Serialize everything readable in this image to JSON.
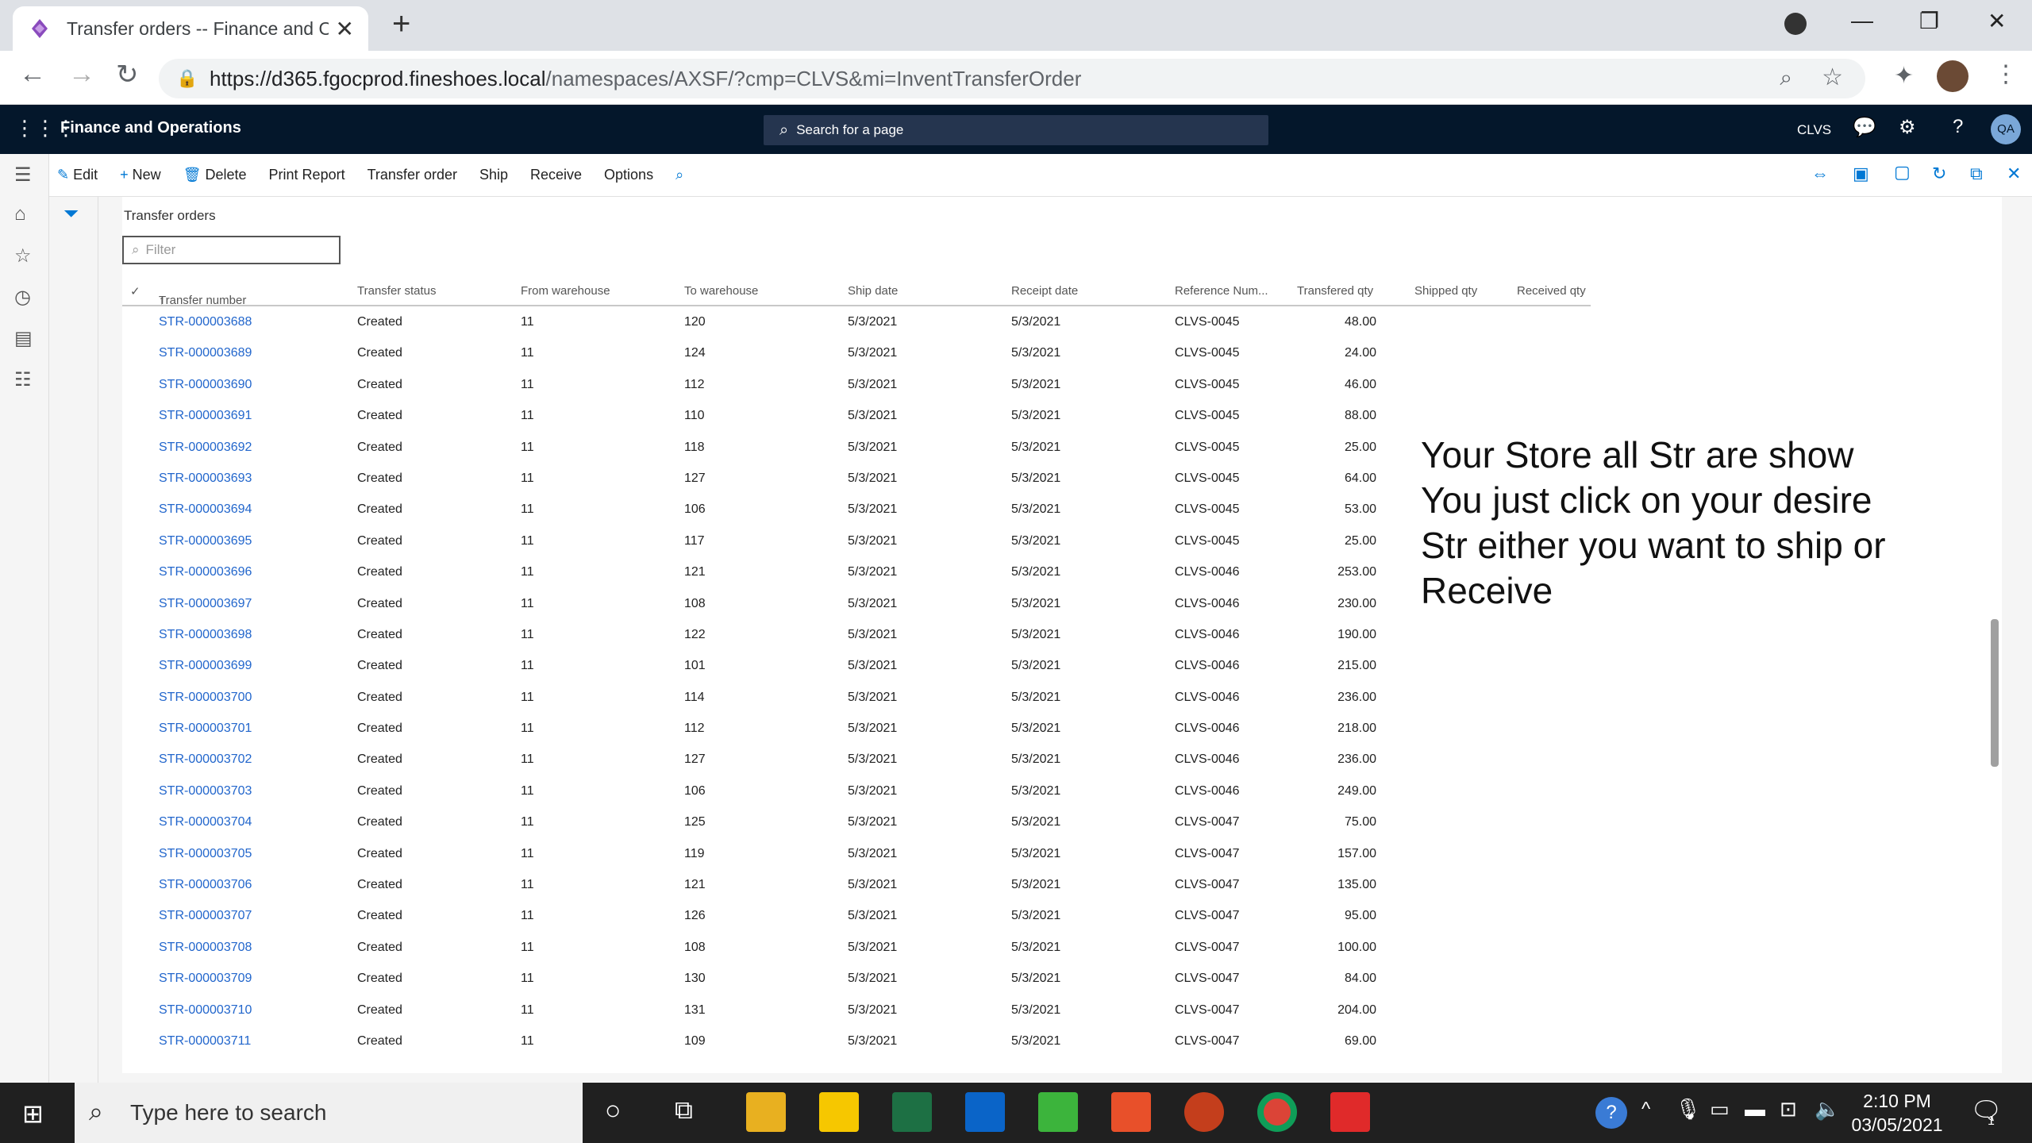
{
  "browser": {
    "tab_title": "Transfer orders -- Finance and Op",
    "url_host": "https://d365.fgocprod.fineshoes.local",
    "url_path": "/namespaces/AXSF/?cmp=CLVS&mi=InventTransferOrder"
  },
  "app": {
    "name": "Finance and Operations",
    "search_placeholder": "Search for a page",
    "company": "CLVS",
    "avatar": "QA"
  },
  "actions": {
    "edit": "Edit",
    "new": "New",
    "delete": "Delete",
    "print_report": "Print Report",
    "transfer_order": "Transfer order",
    "ship": "Ship",
    "receive": "Receive",
    "options": "Options"
  },
  "page": {
    "title": "Transfer orders",
    "filter_placeholder": "Filter"
  },
  "grid": {
    "columns": [
      "Transfer number",
      "Transfer status",
      "From warehouse",
      "To warehouse",
      "Ship date",
      "Receipt date",
      "Reference Num...",
      "Transfered qty",
      "Shipped qty",
      "Received qty"
    ],
    "sort_indicator": "↑",
    "rows": [
      [
        "STR-000003688",
        "Created",
        "11",
        "120",
        "5/3/2021",
        "5/3/2021",
        "CLVS-0045",
        "48.00"
      ],
      [
        "STR-000003689",
        "Created",
        "11",
        "124",
        "5/3/2021",
        "5/3/2021",
        "CLVS-0045",
        "24.00"
      ],
      [
        "STR-000003690",
        "Created",
        "11",
        "112",
        "5/3/2021",
        "5/3/2021",
        "CLVS-0045",
        "46.00"
      ],
      [
        "STR-000003691",
        "Created",
        "11",
        "110",
        "5/3/2021",
        "5/3/2021",
        "CLVS-0045",
        "88.00"
      ],
      [
        "STR-000003692",
        "Created",
        "11",
        "118",
        "5/3/2021",
        "5/3/2021",
        "CLVS-0045",
        "25.00"
      ],
      [
        "STR-000003693",
        "Created",
        "11",
        "127",
        "5/3/2021",
        "5/3/2021",
        "CLVS-0045",
        "64.00"
      ],
      [
        "STR-000003694",
        "Created",
        "11",
        "106",
        "5/3/2021",
        "5/3/2021",
        "CLVS-0045",
        "53.00"
      ],
      [
        "STR-000003695",
        "Created",
        "11",
        "117",
        "5/3/2021",
        "5/3/2021",
        "CLVS-0045",
        "25.00"
      ],
      [
        "STR-000003696",
        "Created",
        "11",
        "121",
        "5/3/2021",
        "5/3/2021",
        "CLVS-0046",
        "253.00"
      ],
      [
        "STR-000003697",
        "Created",
        "11",
        "108",
        "5/3/2021",
        "5/3/2021",
        "CLVS-0046",
        "230.00"
      ],
      [
        "STR-000003698",
        "Created",
        "11",
        "122",
        "5/3/2021",
        "5/3/2021",
        "CLVS-0046",
        "190.00"
      ],
      [
        "STR-000003699",
        "Created",
        "11",
        "101",
        "5/3/2021",
        "5/3/2021",
        "CLVS-0046",
        "215.00"
      ],
      [
        "STR-000003700",
        "Created",
        "11",
        "114",
        "5/3/2021",
        "5/3/2021",
        "CLVS-0046",
        "236.00"
      ],
      [
        "STR-000003701",
        "Created",
        "11",
        "112",
        "5/3/2021",
        "5/3/2021",
        "CLVS-0046",
        "218.00"
      ],
      [
        "STR-000003702",
        "Created",
        "11",
        "127",
        "5/3/2021",
        "5/3/2021",
        "CLVS-0046",
        "236.00"
      ],
      [
        "STR-000003703",
        "Created",
        "11",
        "106",
        "5/3/2021",
        "5/3/2021",
        "CLVS-0046",
        "249.00"
      ],
      [
        "STR-000003704",
        "Created",
        "11",
        "125",
        "5/3/2021",
        "5/3/2021",
        "CLVS-0047",
        "75.00"
      ],
      [
        "STR-000003705",
        "Created",
        "11",
        "119",
        "5/3/2021",
        "5/3/2021",
        "CLVS-0047",
        "157.00"
      ],
      [
        "STR-000003706",
        "Created",
        "11",
        "121",
        "5/3/2021",
        "5/3/2021",
        "CLVS-0047",
        "135.00"
      ],
      [
        "STR-000003707",
        "Created",
        "11",
        "126",
        "5/3/2021",
        "5/3/2021",
        "CLVS-0047",
        "95.00"
      ],
      [
        "STR-000003708",
        "Created",
        "11",
        "108",
        "5/3/2021",
        "5/3/2021",
        "CLVS-0047",
        "100.00"
      ],
      [
        "STR-000003709",
        "Created",
        "11",
        "130",
        "5/3/2021",
        "5/3/2021",
        "CLVS-0047",
        "84.00"
      ],
      [
        "STR-000003710",
        "Created",
        "11",
        "131",
        "5/3/2021",
        "5/3/2021",
        "CLVS-0047",
        "204.00"
      ],
      [
        "STR-000003711",
        "Created",
        "11",
        "109",
        "5/3/2021",
        "5/3/2021",
        "CLVS-0047",
        "69.00"
      ]
    ]
  },
  "annotation": {
    "lines": [
      "Your Store all Str are show",
      "You just click on your desire",
      "Str either you want to ship or",
      "Receive"
    ]
  },
  "taskbar": {
    "search_placeholder": "Type here to search",
    "time": "2:10 PM",
    "date": "03/05/2021",
    "notification_count": "1"
  },
  "colors": {
    "appbar": "#04172b",
    "link": "#2266cc",
    "accent": "#0078d4"
  }
}
